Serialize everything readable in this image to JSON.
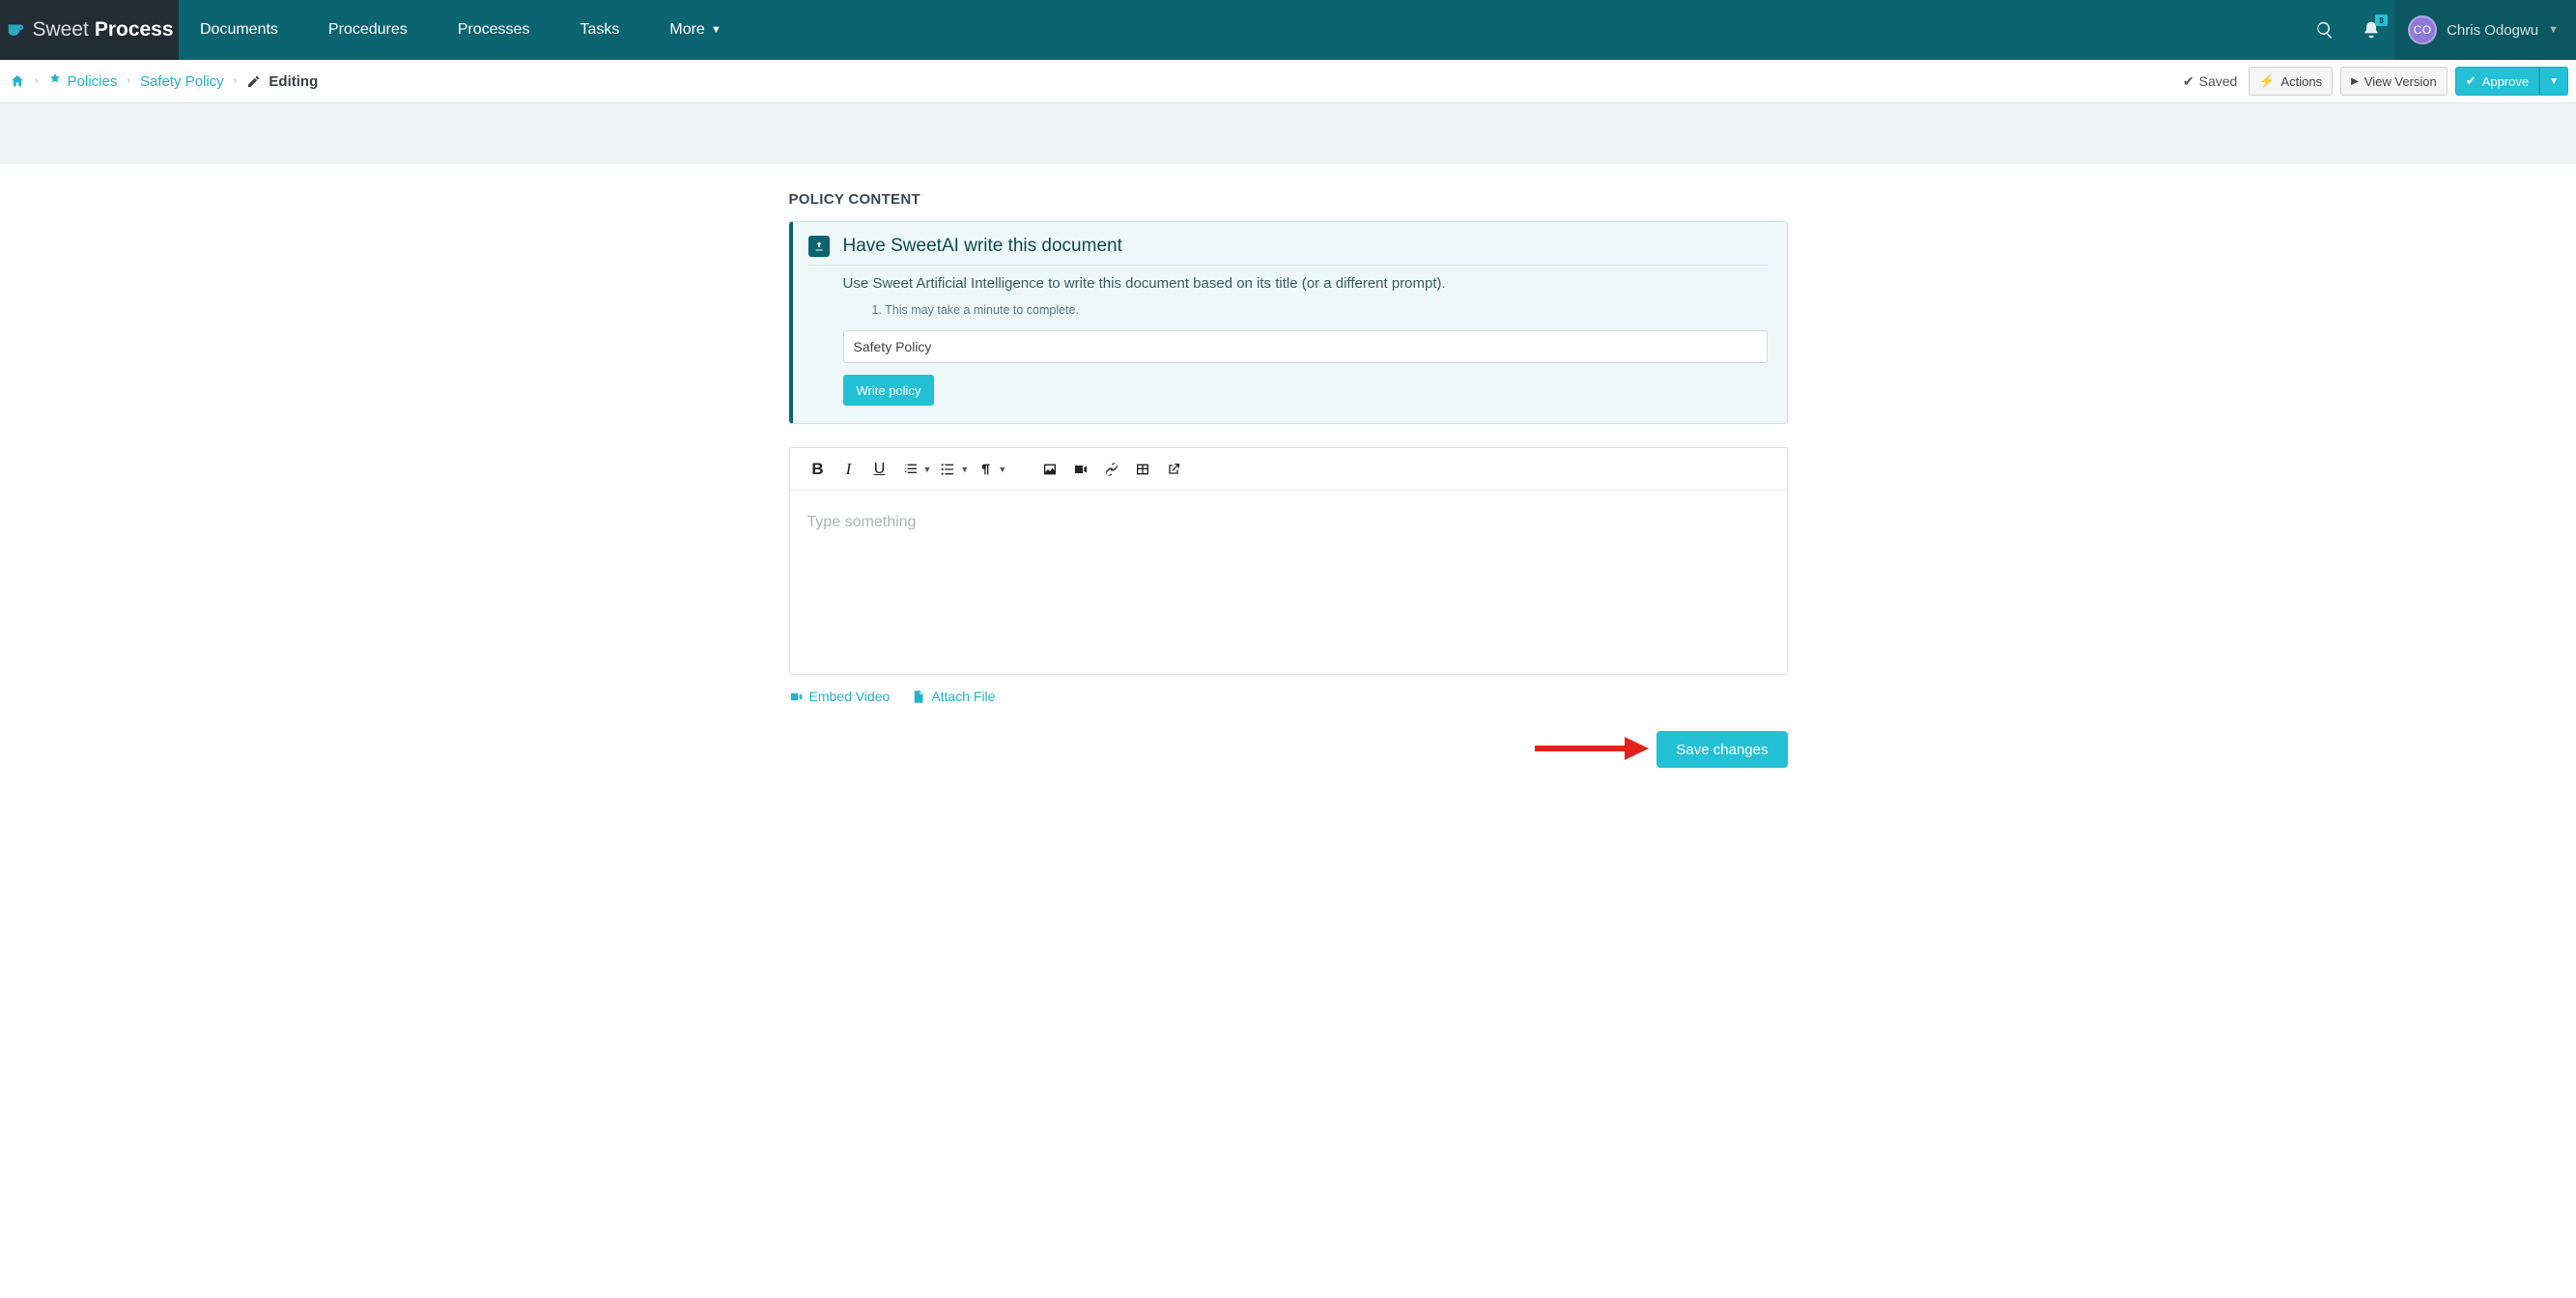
{
  "brand": {
    "light": "Sweet",
    "bold": "Process"
  },
  "nav": {
    "items": [
      "Documents",
      "Procedures",
      "Processes",
      "Tasks"
    ],
    "more": "More",
    "bell_count": "8",
    "user_initials": "CO",
    "user_name": "Chris Odogwu"
  },
  "crumbs": {
    "policies": "Policies",
    "safety": "Safety Policy",
    "editing": "Editing"
  },
  "bar": {
    "saved": "Saved",
    "actions": "Actions",
    "view": "View Version",
    "approve": "Approve"
  },
  "section": {
    "title": "POLICY CONTENT"
  },
  "ai": {
    "title": "Have SweetAI write this document",
    "sub": "Use Sweet Artificial Intelligence to write this document based on its title (or a different prompt).",
    "note": "1. This may take a minute to complete.",
    "input_value": "Safety Policy",
    "write_btn": "Write policy"
  },
  "editor": {
    "placeholder": "Type something"
  },
  "media": {
    "embed": "Embed Video",
    "attach": "Attach File"
  },
  "save": {
    "label": "Save changes"
  }
}
